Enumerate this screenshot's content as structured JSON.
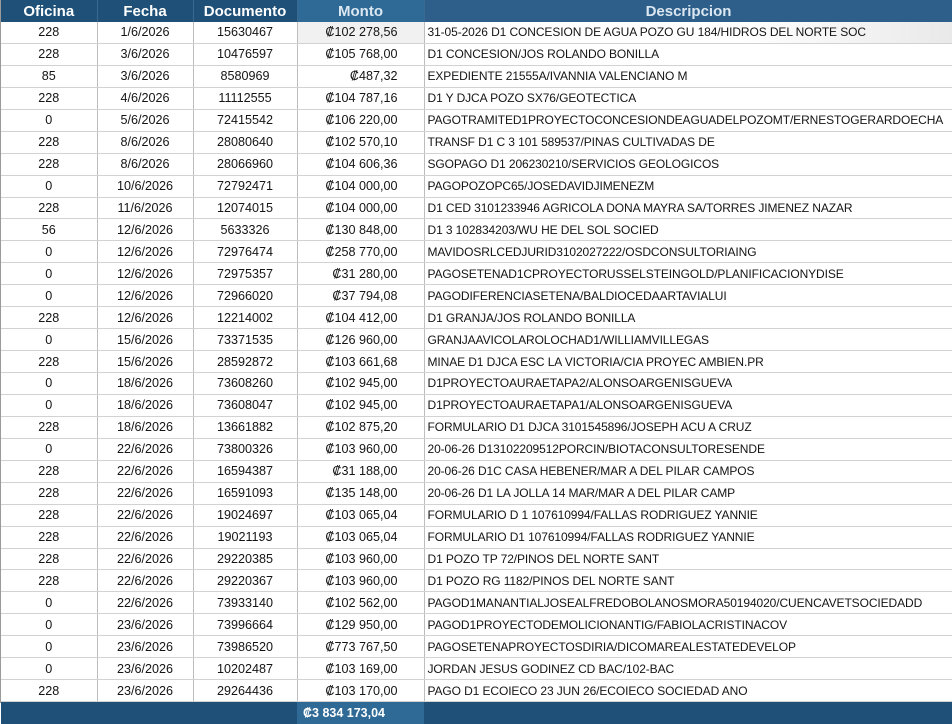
{
  "headers": {
    "oficina": "Oficina",
    "fecha": "Fecha",
    "documento": "Documento",
    "monto": "Monto",
    "descripcion": "Descripcion"
  },
  "rows": [
    {
      "oficina": "228",
      "fecha": "1/6/2026",
      "documento": "15630467",
      "monto": "₡102 278,56",
      "descripcion": "31-05-2026 D1 CONCESION DE AGUA POZO GU 184/HIDROS DEL NORTE SOC"
    },
    {
      "oficina": "228",
      "fecha": "3/6/2026",
      "documento": "10476597",
      "monto": "₡105 768,00",
      "descripcion": "D1 CONCESION/JOS ROLANDO BONILLA"
    },
    {
      "oficina": "85",
      "fecha": "3/6/2026",
      "documento": "8580969",
      "monto": "₡487,32",
      "descripcion": "EXPEDIENTE 21555A/IVANNIA VALENCIANO M"
    },
    {
      "oficina": "228",
      "fecha": "4/6/2026",
      "documento": "11112555",
      "monto": "₡104 787,16",
      "descripcion": "D1 Y DJCA POZO SX76/GEOTECTICA"
    },
    {
      "oficina": "0",
      "fecha": "5/6/2026",
      "documento": "72415542",
      "monto": "₡106 220,00",
      "descripcion": "PAGOTRAMITED1PROYECTOCONCESIONDEAGUADELPOZOMT/ERNESTOGERARDOECHA"
    },
    {
      "oficina": "228",
      "fecha": "8/6/2026",
      "documento": "28080640",
      "monto": "₡102 570,10",
      "descripcion": "TRANSF D1 C 3 101 589537/PINAS CULTIVADAS DE"
    },
    {
      "oficina": "228",
      "fecha": "8/6/2026",
      "documento": "28066960",
      "monto": "₡104 606,36",
      "descripcion": "SGOPAGO D1 206230210/SERVICIOS GEOLOGICOS"
    },
    {
      "oficina": "0",
      "fecha": "10/6/2026",
      "documento": "72792471",
      "monto": "₡104 000,00",
      "descripcion": "PAGOPOZOPC65/JOSEDAVIDJIMENEZM"
    },
    {
      "oficina": "228",
      "fecha": "11/6/2026",
      "documento": "12074015",
      "monto": "₡104 000,00",
      "descripcion": "D1 CED 3101233946 AGRICOLA DONA MAYRA SA/TORRES JIMENEZ NAZAR"
    },
    {
      "oficina": "56",
      "fecha": "12/6/2026",
      "documento": "5633326",
      "monto": "₡130 848,00",
      "descripcion": "D1 3 102834203/WU HE DEL SOL SOCIED"
    },
    {
      "oficina": "0",
      "fecha": "12/6/2026",
      "documento": "72976474",
      "monto": "₡258 770,00",
      "descripcion": "MAVIDOSRLCEDJURID3102027222/OSDCONSULTORIAING"
    },
    {
      "oficina": "0",
      "fecha": "12/6/2026",
      "documento": "72975357",
      "monto": "₡31 280,00",
      "descripcion": "PAGOSETENAD1CPROYECTORUSSELSTEINGOLD/PLANIFICACIONYDISE"
    },
    {
      "oficina": "0",
      "fecha": "12/6/2026",
      "documento": "72966020",
      "monto": "₡37 794,08",
      "descripcion": "PAGODIFERENCIASETENA/BALDIOCEDAARTAVIALUI"
    },
    {
      "oficina": "228",
      "fecha": "12/6/2026",
      "documento": "12214002",
      "monto": "₡104 412,00",
      "descripcion": "D1 GRANJA/JOS ROLANDO BONILLA"
    },
    {
      "oficina": "0",
      "fecha": "15/6/2026",
      "documento": "73371535",
      "monto": "₡126 960,00",
      "descripcion": "GRANJAAVICOLAROLOCHAD1/WILLIAMVILLEGAS"
    },
    {
      "oficina": "228",
      "fecha": "15/6/2026",
      "documento": "28592872",
      "monto": "₡103 661,68",
      "descripcion": "MINAE D1 DJCA ESC LA VICTORIA/CIA PROYEC AMBIEN.PR"
    },
    {
      "oficina": "0",
      "fecha": "18/6/2026",
      "documento": "73608260",
      "monto": "₡102 945,00",
      "descripcion": "D1PROYECTOAURAETAPA2/ALONSOARGENISGUEVA"
    },
    {
      "oficina": "0",
      "fecha": "18/6/2026",
      "documento": "73608047",
      "monto": "₡102 945,00",
      "descripcion": "D1PROYECTOAURAETAPA1/ALONSOARGENISGUEVA"
    },
    {
      "oficina": "228",
      "fecha": "18/6/2026",
      "documento": "13661882",
      "monto": "₡102 875,20",
      "descripcion": "FORMULARIO D1 DJCA 3101545896/JOSEPH ACU A CRUZ"
    },
    {
      "oficina": "0",
      "fecha": "22/6/2026",
      "documento": "73800326",
      "monto": "₡103 960,00",
      "descripcion": "20-06-26 D13102209512PORCIN/BIOTACONSULTORESENDE"
    },
    {
      "oficina": "228",
      "fecha": "22/6/2026",
      "documento": "16594387",
      "monto": "₡31 188,00",
      "descripcion": "20-06-26 D1C CASA HEBENER/MAR A DEL PILAR CAMPOS"
    },
    {
      "oficina": "228",
      "fecha": "22/6/2026",
      "documento": "16591093",
      "monto": "₡135 148,00",
      "descripcion": "20-06-26 D1 LA JOLLA 14 MAR/MAR A DEL PILAR CAMP"
    },
    {
      "oficina": "228",
      "fecha": "22/6/2026",
      "documento": "19024697",
      "monto": "₡103 065,04",
      "descripcion": "FORMULARIO D 1 107610994/FALLAS RODRIGUEZ YANNIE"
    },
    {
      "oficina": "228",
      "fecha": "22/6/2026",
      "documento": "19021193",
      "monto": "₡103 065,04",
      "descripcion": "FORMULARIO D1 107610994/FALLAS RODRIGUEZ YANNIE"
    },
    {
      "oficina": "228",
      "fecha": "22/6/2026",
      "documento": "29220385",
      "monto": "₡103 960,00",
      "descripcion": "D1 POZO TP 72/PINOS DEL NORTE SANT"
    },
    {
      "oficina": "228",
      "fecha": "22/6/2026",
      "documento": "29220367",
      "monto": "₡103 960,00",
      "descripcion": "D1 POZO RG 1182/PINOS DEL NORTE SANT"
    },
    {
      "oficina": "0",
      "fecha": "22/6/2026",
      "documento": "73933140",
      "monto": "₡102 562,00",
      "descripcion": "PAGOD1MANANTIALJOSEALFREDOBOLANOSMORA50194020/CUENCAVETSOCIEDADD"
    },
    {
      "oficina": "0",
      "fecha": "23/6/2026",
      "documento": "73996664",
      "monto": "₡129 950,00",
      "descripcion": "PAGOD1PROYECTODEMOLICIONANTIG/FABIOLACRISTINACOV"
    },
    {
      "oficina": "0",
      "fecha": "23/6/2026",
      "documento": "73986520",
      "monto": "₡773 767,50",
      "descripcion": "PAGOSETENAPROYECTOSDIRIA/DICOMAREALESTATEDEVELOP"
    },
    {
      "oficina": "0",
      "fecha": "23/6/2026",
      "documento": "10202487",
      "monto": "₡103 169,00",
      "descripcion": "JORDAN JESUS GODINEZ CD BAC/102-BAC"
    },
    {
      "oficina": "228",
      "fecha": "23/6/2026",
      "documento": "29264436",
      "monto": "₡103 170,00",
      "descripcion": "PAGO D1 ECOIECO 23 JUN 26/ECOIECO SOCIEDAD ANO"
    }
  ],
  "total": {
    "monto": "₡3 834 173,04"
  },
  "colors": {
    "header_bg": "#1f5078",
    "monto_header_bg": "#2f6a96",
    "header_text": "#ffffff"
  }
}
